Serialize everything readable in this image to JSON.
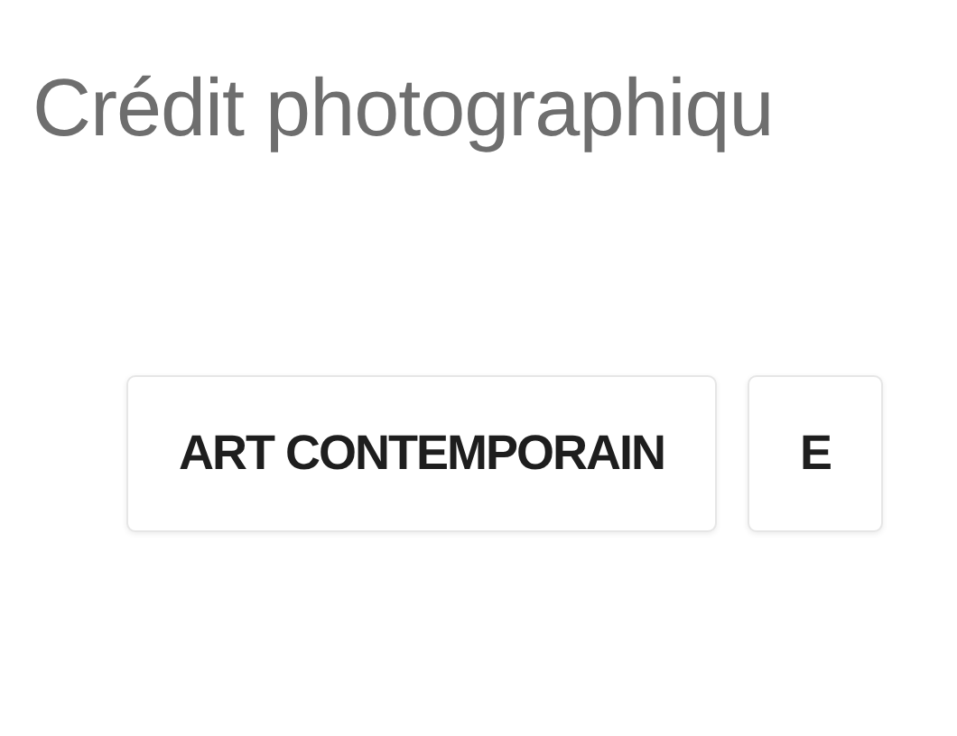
{
  "title": "Crédit photographiqu",
  "tags": [
    {
      "label": "ART CONTEMPORAIN"
    },
    {
      "label": "E"
    }
  ]
}
